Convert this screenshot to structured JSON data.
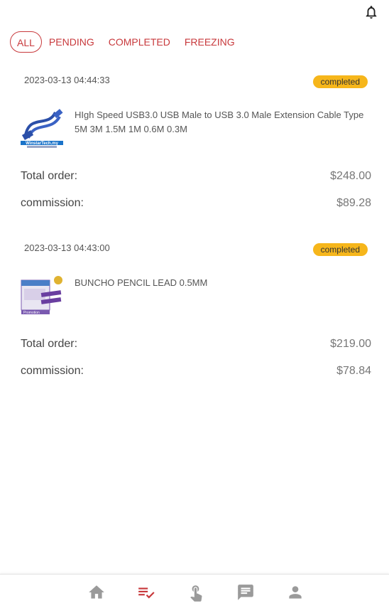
{
  "tabs": [
    {
      "label": "ALL",
      "active": true
    },
    {
      "label": "PENDING",
      "active": false
    },
    {
      "label": "COMPLETED",
      "active": false
    },
    {
      "label": "FREEZING",
      "active": false
    }
  ],
  "orders": [
    {
      "date": "2023-03-13 04:44:33",
      "status": "completed",
      "product_name": "HIgh Speed USB3.0 USB Male to USB 3.0 Male Extension Cable Type 5M 3M 1.5M 1M 0.6M 0.3M",
      "image_caption": "WinstarTech.my",
      "total_label": "Total order:",
      "total_value": "$248.00",
      "commission_label": "commission:",
      "commission_value": "$89.28"
    },
    {
      "date": "2023-03-13 04:43:00",
      "status": "completed",
      "product_name": "BUNCHO PENCIL LEAD 0.5MM",
      "image_caption": "Promotion",
      "total_label": "Total order:",
      "total_value": "$219.00",
      "commission_label": "commission:",
      "commission_value": "$78.84"
    }
  ],
  "nav": [
    {
      "icon": "home-icon",
      "active": false
    },
    {
      "icon": "order-list-icon",
      "active": true
    },
    {
      "icon": "tap-grab-icon",
      "active": false
    },
    {
      "icon": "chat-icon",
      "active": false
    },
    {
      "icon": "profile-icon",
      "active": false
    }
  ],
  "colors": {
    "accent": "#c8393c",
    "badge": "#f6b61b",
    "nav_inactive": "#9a9a9a"
  }
}
